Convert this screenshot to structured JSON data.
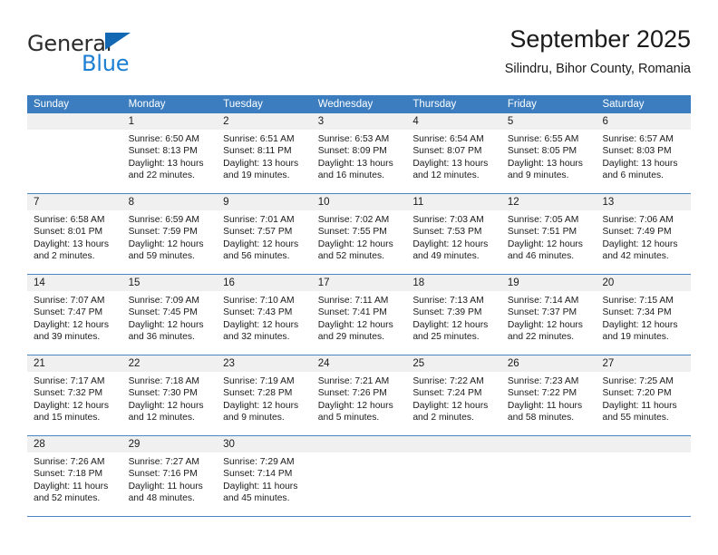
{
  "brand": {
    "name_top": "General",
    "name_bottom": "Blue",
    "triangle_icon": "triangle-icon",
    "color_dark": "#2b2b2b",
    "color_blue": "#1c7fd4"
  },
  "header": {
    "title": "September 2025",
    "subtitle": "Silindru, Bihor County, Romania"
  },
  "colors": {
    "header_row_bg": "#3b7dbf",
    "header_row_text": "#ffffff",
    "day_band_bg": "#f0f0f0",
    "row_divider": "#4a86c4",
    "cell_bg": "#ffffff",
    "text": "#1a1a1a"
  },
  "weekdays": [
    "Sunday",
    "Monday",
    "Tuesday",
    "Wednesday",
    "Thursday",
    "Friday",
    "Saturday"
  ],
  "weeks": [
    [
      {
        "day": "",
        "lines": []
      },
      {
        "day": "1",
        "lines": [
          "Sunrise: 6:50 AM",
          "Sunset: 8:13 PM",
          "Daylight: 13 hours",
          "and 22 minutes."
        ]
      },
      {
        "day": "2",
        "lines": [
          "Sunrise: 6:51 AM",
          "Sunset: 8:11 PM",
          "Daylight: 13 hours",
          "and 19 minutes."
        ]
      },
      {
        "day": "3",
        "lines": [
          "Sunrise: 6:53 AM",
          "Sunset: 8:09 PM",
          "Daylight: 13 hours",
          "and 16 minutes."
        ]
      },
      {
        "day": "4",
        "lines": [
          "Sunrise: 6:54 AM",
          "Sunset: 8:07 PM",
          "Daylight: 13 hours",
          "and 12 minutes."
        ]
      },
      {
        "day": "5",
        "lines": [
          "Sunrise: 6:55 AM",
          "Sunset: 8:05 PM",
          "Daylight: 13 hours",
          "and 9 minutes."
        ]
      },
      {
        "day": "6",
        "lines": [
          "Sunrise: 6:57 AM",
          "Sunset: 8:03 PM",
          "Daylight: 13 hours",
          "and 6 minutes."
        ]
      }
    ],
    [
      {
        "day": "7",
        "lines": [
          "Sunrise: 6:58 AM",
          "Sunset: 8:01 PM",
          "Daylight: 13 hours",
          "and 2 minutes."
        ]
      },
      {
        "day": "8",
        "lines": [
          "Sunrise: 6:59 AM",
          "Sunset: 7:59 PM",
          "Daylight: 12 hours",
          "and 59 minutes."
        ]
      },
      {
        "day": "9",
        "lines": [
          "Sunrise: 7:01 AM",
          "Sunset: 7:57 PM",
          "Daylight: 12 hours",
          "and 56 minutes."
        ]
      },
      {
        "day": "10",
        "lines": [
          "Sunrise: 7:02 AM",
          "Sunset: 7:55 PM",
          "Daylight: 12 hours",
          "and 52 minutes."
        ]
      },
      {
        "day": "11",
        "lines": [
          "Sunrise: 7:03 AM",
          "Sunset: 7:53 PM",
          "Daylight: 12 hours",
          "and 49 minutes."
        ]
      },
      {
        "day": "12",
        "lines": [
          "Sunrise: 7:05 AM",
          "Sunset: 7:51 PM",
          "Daylight: 12 hours",
          "and 46 minutes."
        ]
      },
      {
        "day": "13",
        "lines": [
          "Sunrise: 7:06 AM",
          "Sunset: 7:49 PM",
          "Daylight: 12 hours",
          "and 42 minutes."
        ]
      }
    ],
    [
      {
        "day": "14",
        "lines": [
          "Sunrise: 7:07 AM",
          "Sunset: 7:47 PM",
          "Daylight: 12 hours",
          "and 39 minutes."
        ]
      },
      {
        "day": "15",
        "lines": [
          "Sunrise: 7:09 AM",
          "Sunset: 7:45 PM",
          "Daylight: 12 hours",
          "and 36 minutes."
        ]
      },
      {
        "day": "16",
        "lines": [
          "Sunrise: 7:10 AM",
          "Sunset: 7:43 PM",
          "Daylight: 12 hours",
          "and 32 minutes."
        ]
      },
      {
        "day": "17",
        "lines": [
          "Sunrise: 7:11 AM",
          "Sunset: 7:41 PM",
          "Daylight: 12 hours",
          "and 29 minutes."
        ]
      },
      {
        "day": "18",
        "lines": [
          "Sunrise: 7:13 AM",
          "Sunset: 7:39 PM",
          "Daylight: 12 hours",
          "and 25 minutes."
        ]
      },
      {
        "day": "19",
        "lines": [
          "Sunrise: 7:14 AM",
          "Sunset: 7:37 PM",
          "Daylight: 12 hours",
          "and 22 minutes."
        ]
      },
      {
        "day": "20",
        "lines": [
          "Sunrise: 7:15 AM",
          "Sunset: 7:34 PM",
          "Daylight: 12 hours",
          "and 19 minutes."
        ]
      }
    ],
    [
      {
        "day": "21",
        "lines": [
          "Sunrise: 7:17 AM",
          "Sunset: 7:32 PM",
          "Daylight: 12 hours",
          "and 15 minutes."
        ]
      },
      {
        "day": "22",
        "lines": [
          "Sunrise: 7:18 AM",
          "Sunset: 7:30 PM",
          "Daylight: 12 hours",
          "and 12 minutes."
        ]
      },
      {
        "day": "23",
        "lines": [
          "Sunrise: 7:19 AM",
          "Sunset: 7:28 PM",
          "Daylight: 12 hours",
          "and 9 minutes."
        ]
      },
      {
        "day": "24",
        "lines": [
          "Sunrise: 7:21 AM",
          "Sunset: 7:26 PM",
          "Daylight: 12 hours",
          "and 5 minutes."
        ]
      },
      {
        "day": "25",
        "lines": [
          "Sunrise: 7:22 AM",
          "Sunset: 7:24 PM",
          "Daylight: 12 hours",
          "and 2 minutes."
        ]
      },
      {
        "day": "26",
        "lines": [
          "Sunrise: 7:23 AM",
          "Sunset: 7:22 PM",
          "Daylight: 11 hours",
          "and 58 minutes."
        ]
      },
      {
        "day": "27",
        "lines": [
          "Sunrise: 7:25 AM",
          "Sunset: 7:20 PM",
          "Daylight: 11 hours",
          "and 55 minutes."
        ]
      }
    ],
    [
      {
        "day": "28",
        "lines": [
          "Sunrise: 7:26 AM",
          "Sunset: 7:18 PM",
          "Daylight: 11 hours",
          "and 52 minutes."
        ]
      },
      {
        "day": "29",
        "lines": [
          "Sunrise: 7:27 AM",
          "Sunset: 7:16 PM",
          "Daylight: 11 hours",
          "and 48 minutes."
        ]
      },
      {
        "day": "30",
        "lines": [
          "Sunrise: 7:29 AM",
          "Sunset: 7:14 PM",
          "Daylight: 11 hours",
          "and 45 minutes."
        ]
      },
      {
        "day": "",
        "lines": []
      },
      {
        "day": "",
        "lines": []
      },
      {
        "day": "",
        "lines": []
      },
      {
        "day": "",
        "lines": []
      }
    ]
  ]
}
